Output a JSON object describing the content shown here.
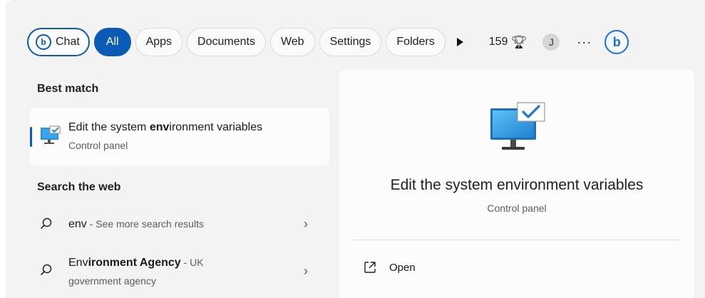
{
  "filters": {
    "chat": "Chat",
    "all": "All",
    "apps": "Apps",
    "documents": "Documents",
    "web": "Web",
    "settings": "Settings",
    "folders": "Folders"
  },
  "rewards": {
    "points": "159"
  },
  "user": {
    "initial": "J"
  },
  "more": "···",
  "best_match": {
    "heading": "Best match",
    "title_pre": "Edit the system ",
    "title_bold": "env",
    "title_post": "ironment variables",
    "subtitle": "Control panel"
  },
  "search_web": {
    "heading": "Search the web",
    "items": [
      {
        "bold": "env",
        "rest": " - See more search results",
        "line2": ""
      },
      {
        "pre": "Env",
        "bold": "ironment Agency",
        "rest": " - UK",
        "line2": "government agency"
      }
    ]
  },
  "detail": {
    "title": "Edit the system environment variables",
    "subtitle": "Control panel",
    "actions": [
      {
        "label": "Open"
      }
    ]
  },
  "icons": {
    "chat": "bing-chat-icon",
    "play": "play-icon",
    "trophy": "trophy-icon",
    "more": "more-icon",
    "bing": "bing-icon",
    "monitor": "monitor-checkmark-icon",
    "search": "search-icon",
    "chevron": "chevron-right-icon",
    "open": "open-external-icon"
  },
  "colors": {
    "accent": "#0a5bb5",
    "panel_bg": "#f3f3f3"
  }
}
